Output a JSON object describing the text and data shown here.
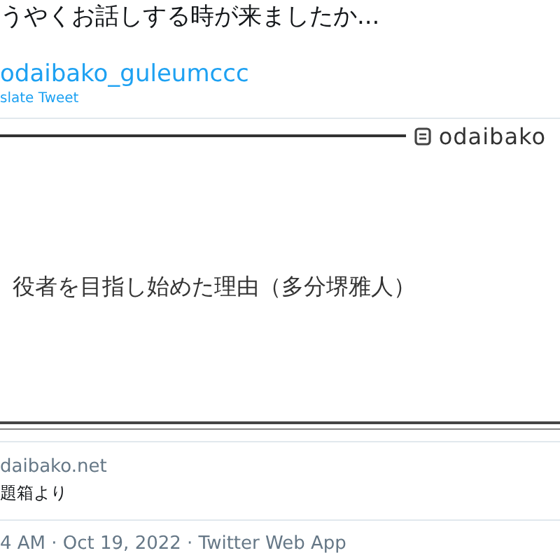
{
  "tweet_text": "うやくお話しする時が来ましたか...",
  "link": "odaibako_guleumccc",
  "translate": "slate Tweet",
  "card": {
    "brand": "odaibako",
    "question": "役者を目指し始めた理由（多分堺雅人）",
    "domain": "daibako.net",
    "description": "題箱より"
  },
  "meta": "4 AM · Oct 19, 2022 · Twitter Web App"
}
